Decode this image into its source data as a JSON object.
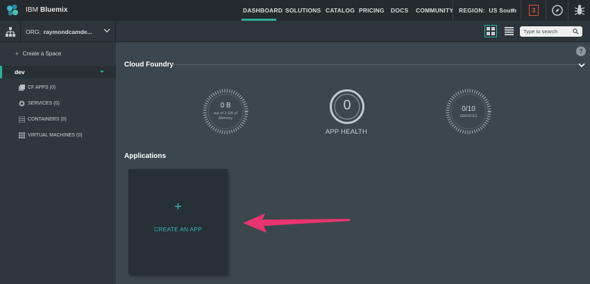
{
  "topbar": {
    "brand_prefix": "IBM",
    "brand_name": "Bluemix",
    "nav": [
      "DASHBOARD",
      "SOLUTIONS",
      "CATALOG",
      "PRICING",
      "DOCS",
      "COMMUNITY"
    ],
    "region_label": "REGION:",
    "region_value": "US South",
    "notification_count": "3",
    "accent_color": "#2bb0a0",
    "notification_color": "#e0533c"
  },
  "orgbar": {
    "org_label": "ORG:",
    "org_name": "raymondcamde...",
    "search_placeholder": "Type to search"
  },
  "sidebar": {
    "create_space": "Create a Space",
    "space_name": "dev",
    "items": [
      {
        "label": "CF APPS (0)",
        "icon": "cf-apps-icon"
      },
      {
        "label": "SERVICES (0)",
        "icon": "services-icon"
      },
      {
        "label": "CONTAINERS (0)",
        "icon": "containers-icon"
      },
      {
        "label": "VIRTUAL MACHINES (0)",
        "icon": "virtual-machines-icon"
      }
    ]
  },
  "main": {
    "section_title": "Cloud Foundry",
    "memory": {
      "value": "0 B",
      "sub1": "out of 2 GB of",
      "sub2": "Memory"
    },
    "health": {
      "value": "0",
      "label": "APP HEALTH"
    },
    "services": {
      "value": "0/10",
      "label": "SERVICES"
    },
    "apps_title": "Applications",
    "create_app_plus": "+",
    "create_app_label": "CREATE AN APP",
    "annotation_arrow_color": "#e8356f"
  }
}
